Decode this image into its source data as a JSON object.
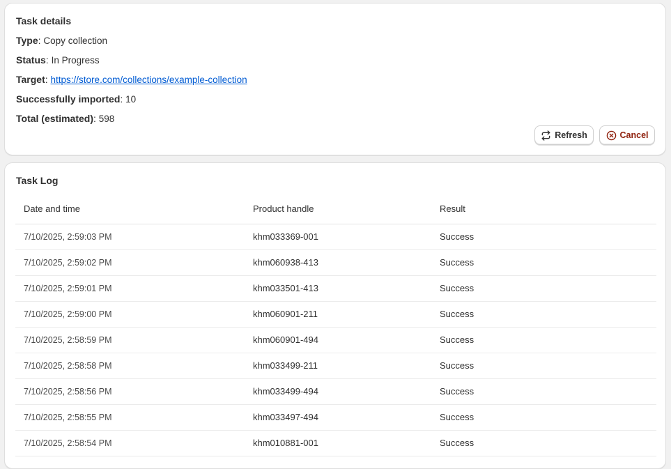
{
  "details": {
    "title": "Task details",
    "type_label": "Type",
    "type_value": "Copy collection",
    "status_label": "Status",
    "status_value": "In Progress",
    "target_label": "Target",
    "target_value": "https://store.com/collections/example-collection",
    "imported_label": "Successfully imported",
    "imported_value": "10",
    "total_label": "Total (estimated)",
    "total_value": "598",
    "refresh_label": "Refresh",
    "cancel_label": "Cancel",
    "refresh_icon": "refresh-icon",
    "cancel_icon": "x-circle-icon",
    "cancel_color": "#8e1f0b",
    "link_color": "#005bd3"
  },
  "log": {
    "title": "Task Log",
    "columns": [
      "Date and time",
      "Product handle",
      "Result"
    ],
    "rows": [
      [
        "7/10/2025, 2:59:03 PM",
        "khm033369-001",
        "Success"
      ],
      [
        "7/10/2025, 2:59:02 PM",
        "khm060938-413",
        "Success"
      ],
      [
        "7/10/2025, 2:59:01 PM",
        "khm033501-413",
        "Success"
      ],
      [
        "7/10/2025, 2:59:00 PM",
        "khm060901-211",
        "Success"
      ],
      [
        "7/10/2025, 2:58:59 PM",
        "khm060901-494",
        "Success"
      ],
      [
        "7/10/2025, 2:58:58 PM",
        "khm033499-211",
        "Success"
      ],
      [
        "7/10/2025, 2:58:56 PM",
        "khm033499-494",
        "Success"
      ],
      [
        "7/10/2025, 2:58:55 PM",
        "khm033497-494",
        "Success"
      ],
      [
        "7/10/2025, 2:58:54 PM",
        "khm010881-001",
        "Success"
      ]
    ]
  }
}
